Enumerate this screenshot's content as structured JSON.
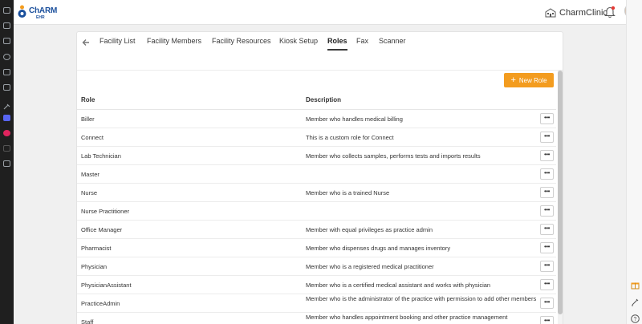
{
  "app": {
    "logo_text": "ChARM",
    "logo_sub": "EHR",
    "clinic_name": "CharmClinic"
  },
  "tabs": [
    {
      "label": "Facility List",
      "active": false
    },
    {
      "label": "Facility Members",
      "active": false
    },
    {
      "label": "Facility Resources",
      "active": false
    },
    {
      "label": "Kiosk Setup",
      "active": false
    },
    {
      "label": "Roles",
      "active": true
    },
    {
      "label": "Fax",
      "active": false
    },
    {
      "label": "Scanner",
      "active": false
    }
  ],
  "actions": {
    "new_role_label": "New Role",
    "plus": "+"
  },
  "table": {
    "headers": {
      "role": "Role",
      "description": "Description"
    },
    "more_label": "•••",
    "rows": [
      {
        "role": "Biller",
        "description": "Member who handles medical billing"
      },
      {
        "role": "Connect",
        "description": "This is a custom role for Connect"
      },
      {
        "role": "Lab Technician",
        "description": "Member who collects samples, performs tests and imports results"
      },
      {
        "role": "Master",
        "description": ""
      },
      {
        "role": "Nurse",
        "description": "Member who is a trained Nurse"
      },
      {
        "role": "Nurse Practitioner",
        "description": ""
      },
      {
        "role": "Office Manager",
        "description": "Member with equal privileges as practice admin"
      },
      {
        "role": "Pharmacist",
        "description": "Member who dispenses drugs and manages inventory"
      },
      {
        "role": "Physician",
        "description": "Member who is a registered medical practitioner"
      },
      {
        "role": "PhysicianAssistant",
        "description": "Member who is a certified medical assistant and works with physician"
      },
      {
        "role": "PracticeAdmin",
        "description": "Member who is the administrator of the practice with permission to add other members"
      },
      {
        "role": "Staff",
        "description": "Member who handles appointment booking and other practice management"
      }
    ]
  },
  "colors": {
    "accent": "#f39c1f",
    "brand": "#1a4f9c",
    "sidebar": "#1f1f1f"
  }
}
